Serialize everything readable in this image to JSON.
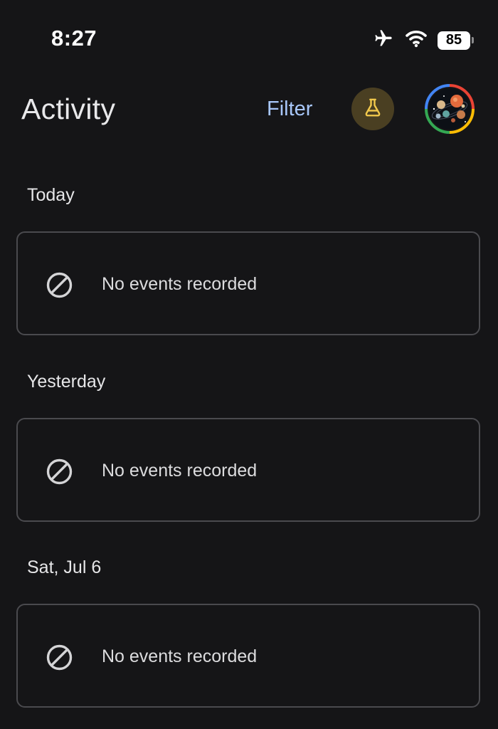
{
  "status_bar": {
    "time": "8:27",
    "battery_level": "85",
    "icons": [
      "airplane-mode-icon",
      "wifi-icon",
      "battery-icon"
    ]
  },
  "header": {
    "title": "Activity",
    "filter_label": "Filter",
    "labs_icon": "flask-icon",
    "avatar_icon": "profile-avatar"
  },
  "sections": [
    {
      "label": "Today",
      "message": "No events recorded",
      "icon": "blocked-icon"
    },
    {
      "label": "Yesterday",
      "message": "No events recorded",
      "icon": "blocked-icon"
    },
    {
      "label": "Sat, Jul 6",
      "message": "No events recorded",
      "icon": "blocked-icon"
    }
  ],
  "colors": {
    "background": "#151517",
    "accent": "#a8c7fa",
    "labs_bg": "#4a3f22",
    "labs_icon": "#f2c94c",
    "card_border": "#4a4a4e"
  }
}
